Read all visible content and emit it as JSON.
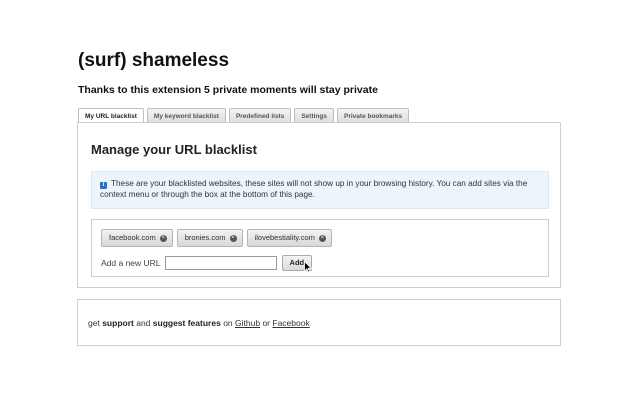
{
  "header": {
    "title": "(surf) shameless",
    "subtitle": "Thanks to this extension 5 private moments will stay private"
  },
  "tabs": [
    {
      "label": "My URL blacklist",
      "active": true
    },
    {
      "label": "My keyword blacklist",
      "active": false
    },
    {
      "label": "Predefined lists",
      "active": false
    },
    {
      "label": "Settings",
      "active": false
    },
    {
      "label": "Private bookmarks",
      "active": false
    }
  ],
  "panel": {
    "title": "Manage your URL blacklist",
    "info_icon": "info-icon",
    "info_text": "These are your blacklisted websites, these sites will not show up in your browsing history. You can add sites via the context menu or through the box at the bottom of this page.",
    "blacklist": [
      {
        "url": "facebook.com"
      },
      {
        "url": "bronies.com"
      },
      {
        "url": "ilovebestiality.com"
      }
    ],
    "add_label": "Add a new URL",
    "add_input_value": "",
    "add_button": "Add"
  },
  "footer": {
    "text_get": "get",
    "text_support": "support",
    "text_and": "and",
    "text_suggest": "suggest features",
    "text_on": "on",
    "link_github": "Github",
    "text_or": "or",
    "link_facebook": "Facebook"
  },
  "colors": {
    "info_background": "#eef4fb",
    "info_icon": "#2f6fce",
    "border": "#cfcfcf"
  }
}
